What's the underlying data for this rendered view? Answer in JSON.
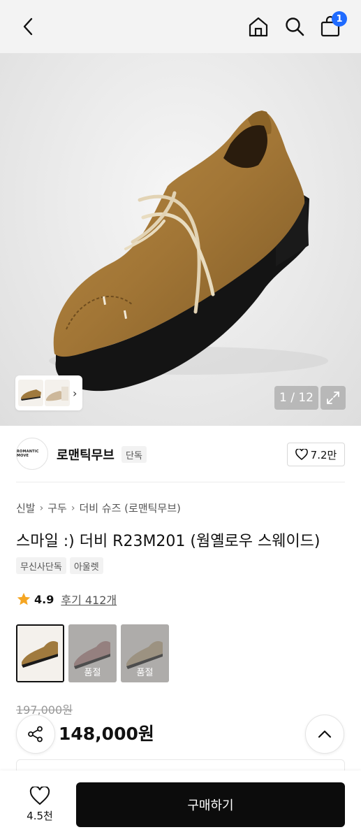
{
  "header": {
    "back_icon": "chevron-left-icon",
    "home_icon": "home-icon",
    "search_icon": "search-icon",
    "cart_icon": "shopping-bag-icon",
    "cart_count": "1",
    "badge_color": "#1f6bff"
  },
  "gallery": {
    "counter": "1 / 12",
    "expand_icon": "expand-icon",
    "thumb_chevron": "›"
  },
  "brand": {
    "logo_text": "ROMANTIC MOVE",
    "name": "로맨틱무브",
    "tag": "단독",
    "like_count": "7.2만"
  },
  "breadcrumb": [
    "신발",
    "구두",
    "더비 슈즈 (로맨틱무브)"
  ],
  "product": {
    "title": "스마일 :) 더비 R23M201 (웜옐로우 스웨이드)",
    "tags": [
      "무신사단독",
      "아울렛"
    ],
    "rating": "4.9",
    "reviews": "후기 412개",
    "star_color": "#f5a623",
    "original_price": "197,000원",
    "price": "148,000원"
  },
  "options": [
    {
      "color": "#a07a3e",
      "soldout": false,
      "label": ""
    },
    {
      "color": "#b88a88",
      "soldout": true,
      "label": "품절"
    },
    {
      "color": "#c7b28c",
      "soldout": true,
      "label": "품절"
    }
  ],
  "bottom": {
    "like_count": "4.5천",
    "buy_label": "구매하기"
  }
}
